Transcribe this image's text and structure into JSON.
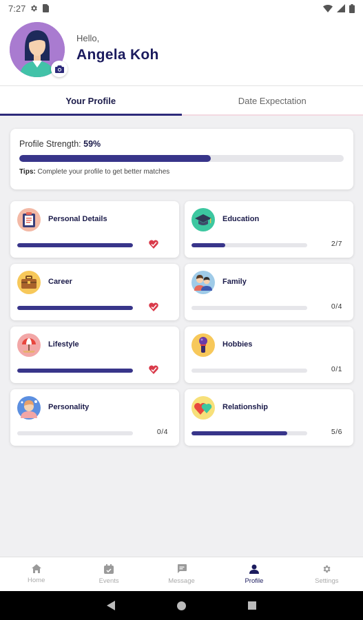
{
  "status_bar": {
    "time": "7:27",
    "icons": [
      "settings-gear-icon",
      "sim-card-icon",
      "wifi-icon",
      "cell-signal-icon",
      "battery-icon"
    ]
  },
  "header": {
    "greeting": "Hello,",
    "name": "Angela Koh",
    "avatar_bg": "#a97bd0"
  },
  "tabs": [
    {
      "label": "Your Profile",
      "active": true
    },
    {
      "label": "Date Expectation",
      "active": false
    }
  ],
  "profile_strength": {
    "label": "Profile Strength:",
    "value_text": "59%",
    "value": 0.59,
    "tips_label": "Tips:",
    "tips_text": "Complete your profile to get better matches"
  },
  "sections": [
    {
      "label": "Personal Details",
      "icon": "clipboard-icon",
      "icon_bg": "#f3b9a6",
      "progress": 1.0,
      "complete": true,
      "count": ""
    },
    {
      "label": "Education",
      "icon": "graduation-cap-icon",
      "icon_bg": "#3cc7a0",
      "progress": 0.29,
      "complete": false,
      "count": "2/7"
    },
    {
      "label": "Career",
      "icon": "briefcase-icon",
      "icon_bg": "#f7c85a",
      "progress": 1.0,
      "complete": true,
      "count": ""
    },
    {
      "label": "Family",
      "icon": "family-icon",
      "icon_bg": "#9fcbe8",
      "progress": 0,
      "complete": false,
      "count": "0/4"
    },
    {
      "label": "Lifestyle",
      "icon": "beach-umbrella-icon",
      "icon_bg": "#f2a7a7",
      "progress": 1.0,
      "complete": true,
      "count": ""
    },
    {
      "label": "Hobbies",
      "icon": "microphone-icon",
      "icon_bg": "#f7c85a",
      "progress": 0,
      "complete": false,
      "count": "0/1"
    },
    {
      "label": "Personality",
      "icon": "person-thinking-icon",
      "icon_bg": "#5c8fe0",
      "progress": 0,
      "complete": false,
      "count": "0/4"
    },
    {
      "label": "Relationship",
      "icon": "hearts-icon",
      "icon_bg": "#f7e07a",
      "progress": 0.83,
      "complete": false,
      "count": "5/6"
    }
  ],
  "bottom_nav": [
    {
      "label": "Home",
      "icon": "home-icon",
      "active": false
    },
    {
      "label": "Events",
      "icon": "calendar-icon",
      "active": false
    },
    {
      "label": "Message",
      "icon": "chat-bubble-icon",
      "active": false
    },
    {
      "label": "Profile",
      "icon": "person-icon",
      "active": true
    },
    {
      "label": "Settings",
      "icon": "gear-icon",
      "active": false
    }
  ],
  "colors": {
    "accent": "#38358a",
    "heart": "#d93a4a",
    "track": "#e6e6ea"
  }
}
